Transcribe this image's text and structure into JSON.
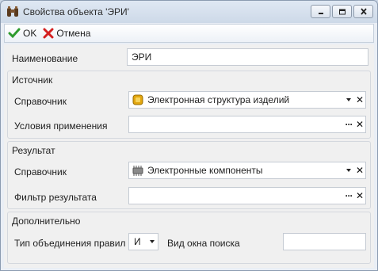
{
  "window": {
    "title": "Свойства объекта 'ЭРИ'"
  },
  "toolbar": {
    "ok_label": "OK",
    "cancel_label": "Отмена"
  },
  "name_row": {
    "label": "Наименование",
    "value": "ЭРИ"
  },
  "source_group": {
    "title": "Источник",
    "directory_label": "Справочник",
    "directory_value": "Электронная структура изделий",
    "conditions_label": "Условия применения",
    "conditions_value": ""
  },
  "result_group": {
    "title": "Результат",
    "directory_label": "Справочник",
    "directory_value": "Электронные компоненты",
    "filter_label": "Фильтр результата",
    "filter_value": ""
  },
  "extra_group": {
    "title": "Дополнительно",
    "join_type_label": "Тип объединения правил",
    "join_type_value": "И",
    "search_view_label": "Вид окна поиска",
    "search_view_value": ""
  },
  "colors": {
    "ok_green": "#2e9b2e",
    "cancel_red": "#d42020",
    "accent_blue": "#1e6fd0"
  }
}
